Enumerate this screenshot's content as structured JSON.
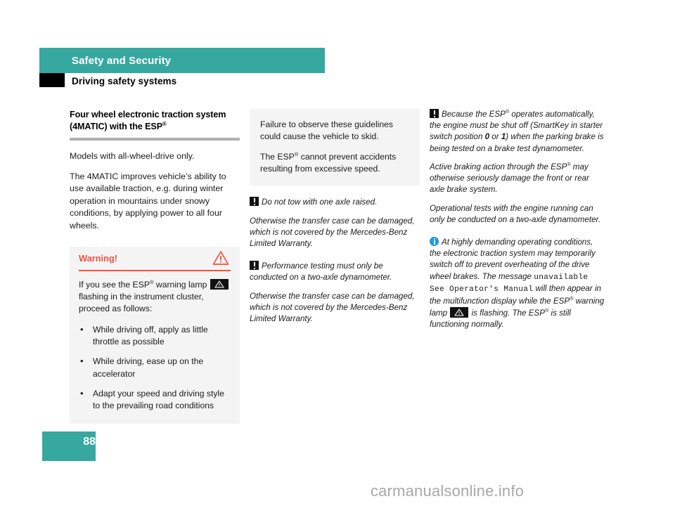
{
  "header": {
    "chapter_title": "Safety and Security",
    "section_title": "Driving safety systems",
    "chapter_bar_color": "#37a8a0",
    "section_swatch_color": "#000000"
  },
  "column_1": {
    "subhead_line_1": "Four wheel electronic traction system",
    "subhead_line_2_prefix": "(4MATIC) with the ESP",
    "registered_mark": "®",
    "para_1": "Models with all-wheel-drive only.",
    "para_2": "The 4MATIC improves vehicle’s ability to use available traction, e.g. during winter operation in mountains under snowy conditions, by applying power to all four wheels.",
    "warning_box": {
      "label": "Warning!",
      "icon_name": "warning-triangle-icon",
      "accent_color": "#f4503c",
      "background_color": "#f4f4f4",
      "intro_part_1": "If you see the ESP",
      "intro_part_2": " warning lamp ",
      "lamp_icon_name": "esp-warning-lamp-icon",
      "intro_part_3": " flashing in the instrument cluster, proceed as follows:",
      "bullets": [
        "While driving off, apply as little throttle as possible",
        "While driving, ease up on the accelerator",
        "Adapt your speed and driving style to the prevailing road conditions"
      ]
    }
  },
  "column_2": {
    "guideline_box": {
      "background_color": "#f4f4f4",
      "para_1": "Failure to observe these guidelines could cause the vehicle to skid.",
      "para_2_prefix": "The ESP",
      "para_2_suffix": " cannot prevent accidents resulting from excessive speed."
    },
    "note_1": {
      "icon_name": "exclamation-box-icon",
      "lead": "Do not tow with one axle raised.",
      "body": "Otherwise the transfer case can be damaged, which is not covered by the Mercedes-Benz Limited Warranty."
    },
    "note_2": {
      "icon_name": "exclamation-box-icon",
      "lead": "Performance testing must only be conducted on a two-axle dynamometer.",
      "body": "Otherwise the transfer case can be damaged, which is not covered by the Mercedes-Benz Limited Warranty."
    }
  },
  "column_3": {
    "note_1": {
      "icon_name": "exclamation-box-icon",
      "lead_part_1": "Because the ESP",
      "lead_part_2": " operates automatically, the engine must be shut off (SmartKey in starter switch position ",
      "position_a": "0",
      "lead_part_3": " or ",
      "position_b": "1",
      "lead_part_4": ") when the parking brake is being tested on a brake test dynamometer."
    },
    "para_1_prefix": "Active braking action through the ESP",
    "para_1_suffix": " may otherwise seriously damage the front or rear axle brake system.",
    "para_2": "Operational tests with the engine running can only be conducted on a two-axle dynamometer.",
    "note_2": {
      "icon_name": "info-circle-icon",
      "icon_color": "#2196dd",
      "part_1": "At highly demanding operating conditions, the electronic traction system may temporarily switch off to prevent overheating of the drive wheel brakes. The message ",
      "message_mono": "unavailable See Operator's Manual",
      "part_2": " will then appear in the multifunction display while the ESP",
      "part_3": " warning lamp ",
      "lamp_icon_name": "esp-warning-lamp-icon",
      "part_4": " is flashing. The ESP",
      "part_5": " is still functioning normally."
    }
  },
  "footer": {
    "page_number": "88",
    "page_box_color": "#37a8a0",
    "watermark": "carmanualsonline.info"
  }
}
